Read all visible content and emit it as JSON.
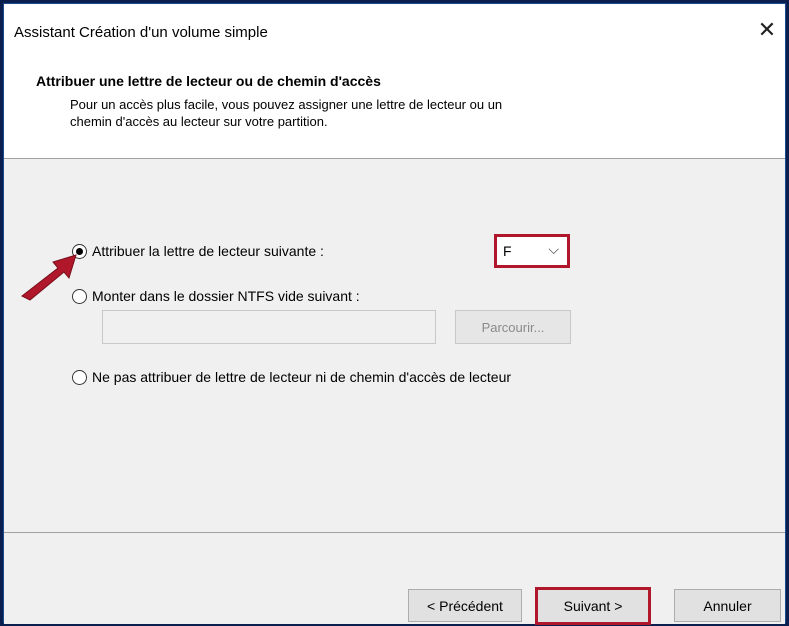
{
  "window": {
    "title": "Assistant Création d'un volume simple",
    "close_icon": "close-icon"
  },
  "header": {
    "title": "Attribuer une lettre de lecteur ou de chemin d'accès",
    "description_line1": "Pour un accès plus facile, vous pouvez assigner une lettre de lecteur ou un",
    "description_line2": "chemin d'accès au lecteur sur votre partition."
  },
  "options": {
    "assign_letter": {
      "label": "Attribuer la lettre de lecteur suivante :",
      "selected": true
    },
    "mount_ntfs": {
      "label": "Monter dans le dossier NTFS vide suivant :",
      "selected": false
    },
    "no_assign": {
      "label": "Ne pas attribuer de lettre de lecteur ni de chemin d'accès de lecteur",
      "selected": false
    }
  },
  "drive_select": {
    "value": "F"
  },
  "path_input": {
    "value": ""
  },
  "browse_button": {
    "label": "Parcourir..."
  },
  "footer": {
    "prev_label": "< Précédent",
    "next_label": "Suivant >",
    "cancel_label": "Annuler"
  },
  "colors": {
    "highlight": "#b0172a",
    "desktop": "#0a1f4d"
  }
}
